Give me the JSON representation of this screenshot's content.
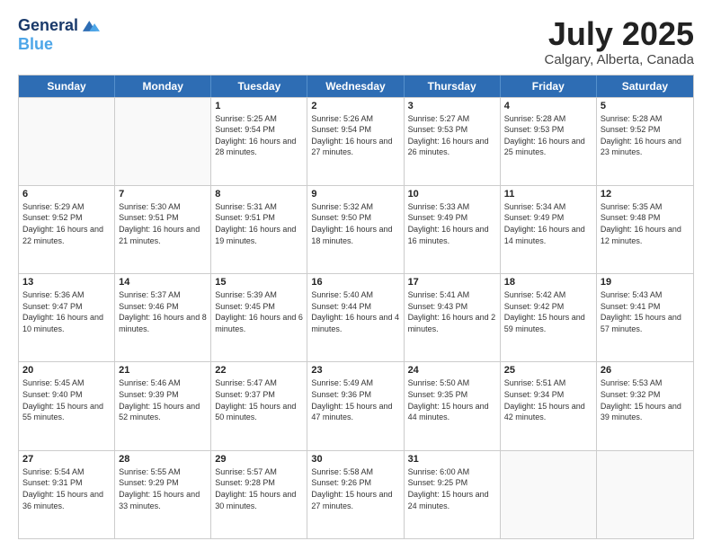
{
  "header": {
    "logo_line1": "General",
    "logo_line2": "Blue",
    "month_year": "July 2025",
    "location": "Calgary, Alberta, Canada"
  },
  "weekdays": [
    "Sunday",
    "Monday",
    "Tuesday",
    "Wednesday",
    "Thursday",
    "Friday",
    "Saturday"
  ],
  "rows": [
    [
      {
        "day": "",
        "sunrise": "",
        "sunset": "",
        "daylight": ""
      },
      {
        "day": "",
        "sunrise": "",
        "sunset": "",
        "daylight": ""
      },
      {
        "day": "1",
        "sunrise": "Sunrise: 5:25 AM",
        "sunset": "Sunset: 9:54 PM",
        "daylight": "Daylight: 16 hours and 28 minutes."
      },
      {
        "day": "2",
        "sunrise": "Sunrise: 5:26 AM",
        "sunset": "Sunset: 9:54 PM",
        "daylight": "Daylight: 16 hours and 27 minutes."
      },
      {
        "day": "3",
        "sunrise": "Sunrise: 5:27 AM",
        "sunset": "Sunset: 9:53 PM",
        "daylight": "Daylight: 16 hours and 26 minutes."
      },
      {
        "day": "4",
        "sunrise": "Sunrise: 5:28 AM",
        "sunset": "Sunset: 9:53 PM",
        "daylight": "Daylight: 16 hours and 25 minutes."
      },
      {
        "day": "5",
        "sunrise": "Sunrise: 5:28 AM",
        "sunset": "Sunset: 9:52 PM",
        "daylight": "Daylight: 16 hours and 23 minutes."
      }
    ],
    [
      {
        "day": "6",
        "sunrise": "Sunrise: 5:29 AM",
        "sunset": "Sunset: 9:52 PM",
        "daylight": "Daylight: 16 hours and 22 minutes."
      },
      {
        "day": "7",
        "sunrise": "Sunrise: 5:30 AM",
        "sunset": "Sunset: 9:51 PM",
        "daylight": "Daylight: 16 hours and 21 minutes."
      },
      {
        "day": "8",
        "sunrise": "Sunrise: 5:31 AM",
        "sunset": "Sunset: 9:51 PM",
        "daylight": "Daylight: 16 hours and 19 minutes."
      },
      {
        "day": "9",
        "sunrise": "Sunrise: 5:32 AM",
        "sunset": "Sunset: 9:50 PM",
        "daylight": "Daylight: 16 hours and 18 minutes."
      },
      {
        "day": "10",
        "sunrise": "Sunrise: 5:33 AM",
        "sunset": "Sunset: 9:49 PM",
        "daylight": "Daylight: 16 hours and 16 minutes."
      },
      {
        "day": "11",
        "sunrise": "Sunrise: 5:34 AM",
        "sunset": "Sunset: 9:49 PM",
        "daylight": "Daylight: 16 hours and 14 minutes."
      },
      {
        "day": "12",
        "sunrise": "Sunrise: 5:35 AM",
        "sunset": "Sunset: 9:48 PM",
        "daylight": "Daylight: 16 hours and 12 minutes."
      }
    ],
    [
      {
        "day": "13",
        "sunrise": "Sunrise: 5:36 AM",
        "sunset": "Sunset: 9:47 PM",
        "daylight": "Daylight: 16 hours and 10 minutes."
      },
      {
        "day": "14",
        "sunrise": "Sunrise: 5:37 AM",
        "sunset": "Sunset: 9:46 PM",
        "daylight": "Daylight: 16 hours and 8 minutes."
      },
      {
        "day": "15",
        "sunrise": "Sunrise: 5:39 AM",
        "sunset": "Sunset: 9:45 PM",
        "daylight": "Daylight: 16 hours and 6 minutes."
      },
      {
        "day": "16",
        "sunrise": "Sunrise: 5:40 AM",
        "sunset": "Sunset: 9:44 PM",
        "daylight": "Daylight: 16 hours and 4 minutes."
      },
      {
        "day": "17",
        "sunrise": "Sunrise: 5:41 AM",
        "sunset": "Sunset: 9:43 PM",
        "daylight": "Daylight: 16 hours and 2 minutes."
      },
      {
        "day": "18",
        "sunrise": "Sunrise: 5:42 AM",
        "sunset": "Sunset: 9:42 PM",
        "daylight": "Daylight: 15 hours and 59 minutes."
      },
      {
        "day": "19",
        "sunrise": "Sunrise: 5:43 AM",
        "sunset": "Sunset: 9:41 PM",
        "daylight": "Daylight: 15 hours and 57 minutes."
      }
    ],
    [
      {
        "day": "20",
        "sunrise": "Sunrise: 5:45 AM",
        "sunset": "Sunset: 9:40 PM",
        "daylight": "Daylight: 15 hours and 55 minutes."
      },
      {
        "day": "21",
        "sunrise": "Sunrise: 5:46 AM",
        "sunset": "Sunset: 9:39 PM",
        "daylight": "Daylight: 15 hours and 52 minutes."
      },
      {
        "day": "22",
        "sunrise": "Sunrise: 5:47 AM",
        "sunset": "Sunset: 9:37 PM",
        "daylight": "Daylight: 15 hours and 50 minutes."
      },
      {
        "day": "23",
        "sunrise": "Sunrise: 5:49 AM",
        "sunset": "Sunset: 9:36 PM",
        "daylight": "Daylight: 15 hours and 47 minutes."
      },
      {
        "day": "24",
        "sunrise": "Sunrise: 5:50 AM",
        "sunset": "Sunset: 9:35 PM",
        "daylight": "Daylight: 15 hours and 44 minutes."
      },
      {
        "day": "25",
        "sunrise": "Sunrise: 5:51 AM",
        "sunset": "Sunset: 9:34 PM",
        "daylight": "Daylight: 15 hours and 42 minutes."
      },
      {
        "day": "26",
        "sunrise": "Sunrise: 5:53 AM",
        "sunset": "Sunset: 9:32 PM",
        "daylight": "Daylight: 15 hours and 39 minutes."
      }
    ],
    [
      {
        "day": "27",
        "sunrise": "Sunrise: 5:54 AM",
        "sunset": "Sunset: 9:31 PM",
        "daylight": "Daylight: 15 hours and 36 minutes."
      },
      {
        "day": "28",
        "sunrise": "Sunrise: 5:55 AM",
        "sunset": "Sunset: 9:29 PM",
        "daylight": "Daylight: 15 hours and 33 minutes."
      },
      {
        "day": "29",
        "sunrise": "Sunrise: 5:57 AM",
        "sunset": "Sunset: 9:28 PM",
        "daylight": "Daylight: 15 hours and 30 minutes."
      },
      {
        "day": "30",
        "sunrise": "Sunrise: 5:58 AM",
        "sunset": "Sunset: 9:26 PM",
        "daylight": "Daylight: 15 hours and 27 minutes."
      },
      {
        "day": "31",
        "sunrise": "Sunrise: 6:00 AM",
        "sunset": "Sunset: 9:25 PM",
        "daylight": "Daylight: 15 hours and 24 minutes."
      },
      {
        "day": "",
        "sunrise": "",
        "sunset": "",
        "daylight": ""
      },
      {
        "day": "",
        "sunrise": "",
        "sunset": "",
        "daylight": ""
      }
    ]
  ]
}
